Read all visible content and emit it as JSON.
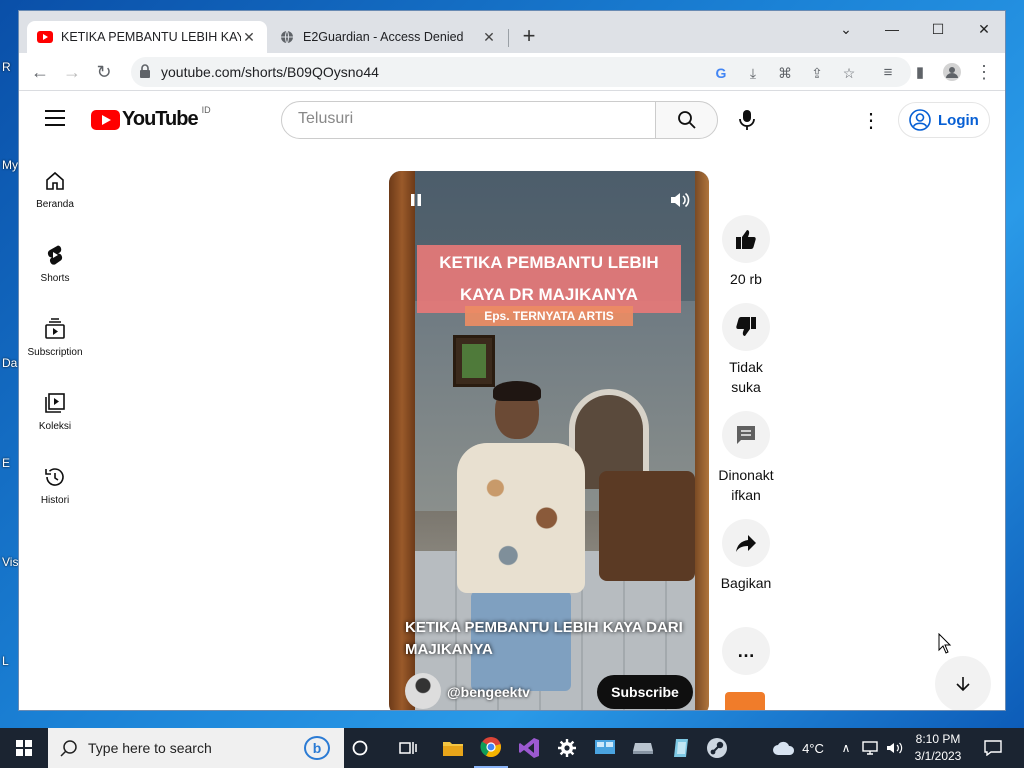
{
  "desktop": {
    "icon_labels": [
      "R",
      "My",
      "Da",
      "E",
      "Vis",
      "L"
    ]
  },
  "browser": {
    "tabs": [
      {
        "title": "KETIKA PEMBANTU LEBIH KAYA D",
        "icon": "youtube-icon",
        "active": true
      },
      {
        "title": "E2Guardian - Access Denied",
        "icon": "globe-icon",
        "active": false
      }
    ],
    "new_tab": "+",
    "url": "youtube.com/shorts/B09QOysno44"
  },
  "youtube": {
    "logo_text": "YouTube",
    "country_code": "ID",
    "search_placeholder": "Telusuri",
    "login_label": "Login",
    "sidebar": [
      {
        "label": "Beranda",
        "icon": "home-icon"
      },
      {
        "label": "Shorts",
        "icon": "shorts-icon"
      },
      {
        "label": "Subscription",
        "icon": "subscriptions-icon"
      },
      {
        "label": "Koleksi",
        "icon": "library-icon"
      },
      {
        "label": "Histori",
        "icon": "history-icon"
      }
    ],
    "short": {
      "banner_title": "KETIKA PEMBANTU LEBIH KAYA DR MAJIKANYA",
      "banner_subtitle": "Eps. TERNYATA ARTIS",
      "title": "KETIKA PEMBANTU LEBIH KAYA DARI MAJIKANYA",
      "channel": "@bengeektv",
      "subscribe_label": "Subscribe"
    },
    "actions": {
      "like": "20 rb",
      "dislike": "Tidak suka",
      "comments": "Dinonaktifkan",
      "share": "Bagikan",
      "more": "…"
    }
  },
  "taskbar": {
    "search_placeholder": "Type here to search",
    "weather": "4°C",
    "time": "8:10 PM",
    "date": "3/1/2023"
  },
  "colors": {
    "youtube_red": "#ff0000",
    "link_blue": "#065fd4",
    "taskbar": "#1b2431"
  }
}
